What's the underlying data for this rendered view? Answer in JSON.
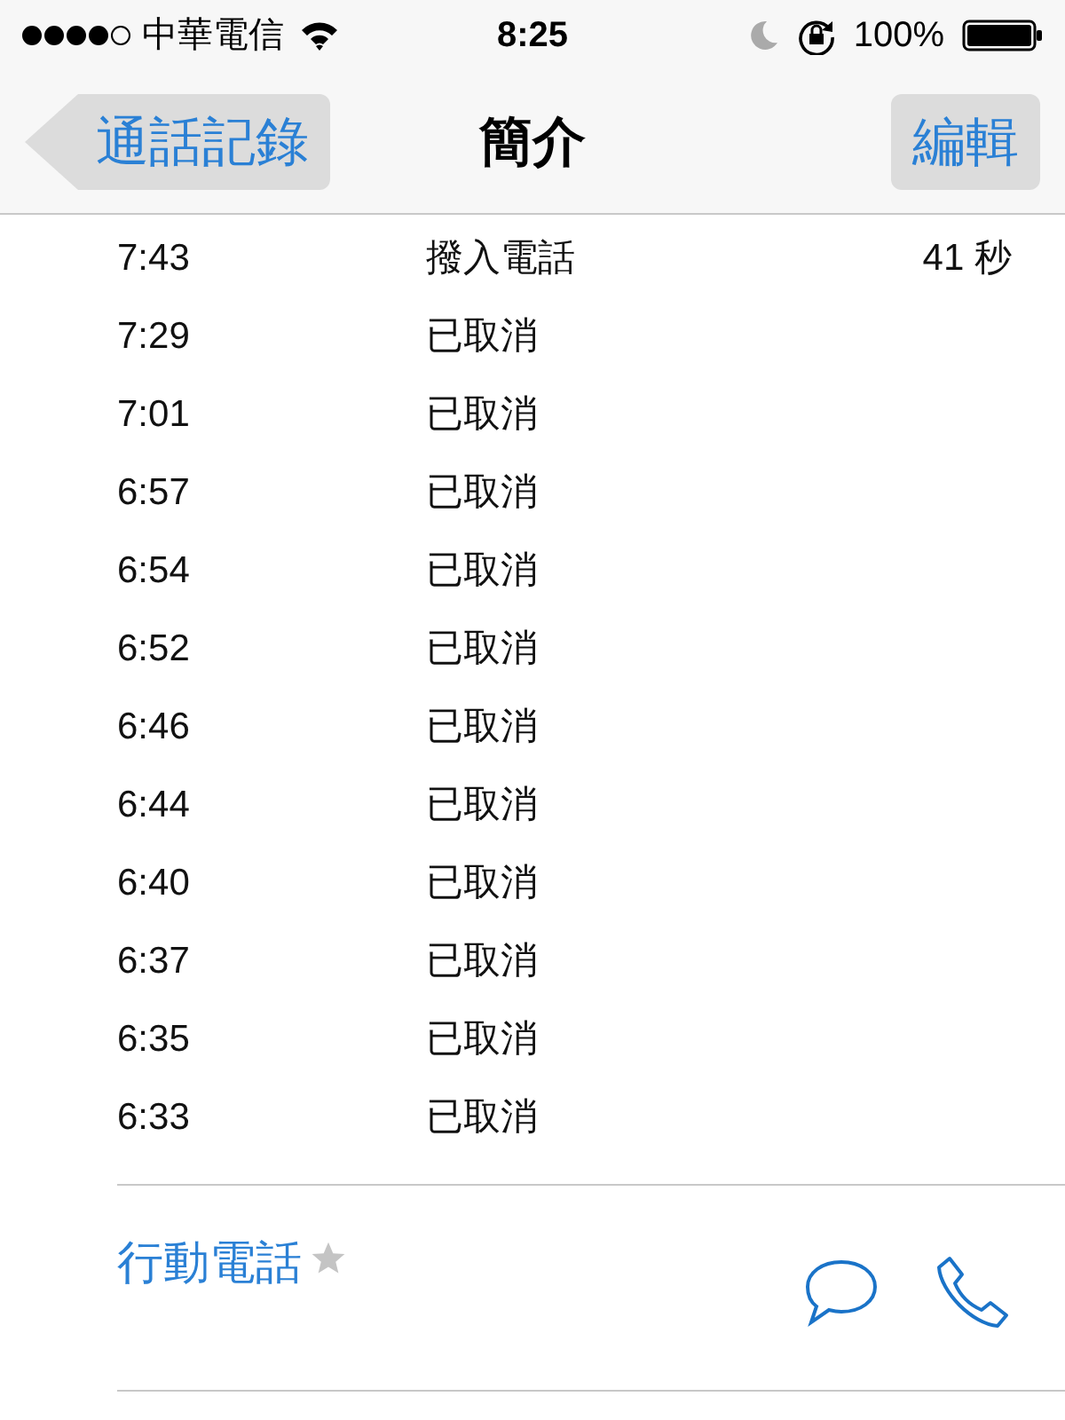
{
  "status_bar": {
    "carrier": "中華電信",
    "time": "8:25",
    "battery": "100%"
  },
  "nav": {
    "back": "通話記錄",
    "title": "簡介",
    "edit": "編輯"
  },
  "calls": [
    {
      "time": "7:43",
      "type": "撥入電話",
      "duration": "41 秒"
    },
    {
      "time": "7:29",
      "type": "已取消"
    },
    {
      "time": "7:01",
      "type": "已取消"
    },
    {
      "time": "6:57",
      "type": "已取消"
    },
    {
      "time": "6:54",
      "type": "已取消"
    },
    {
      "time": "6:52",
      "type": "已取消"
    },
    {
      "time": "6:46",
      "type": "已取消"
    },
    {
      "time": "6:44",
      "type": "已取消"
    },
    {
      "time": "6:40",
      "type": "已取消"
    },
    {
      "time": "6:37",
      "type": "已取消"
    },
    {
      "time": "6:35",
      "type": "已取消"
    },
    {
      "time": "6:33",
      "type": "已取消"
    }
  ],
  "phone": {
    "label": "行動電話",
    "favorite": false
  }
}
